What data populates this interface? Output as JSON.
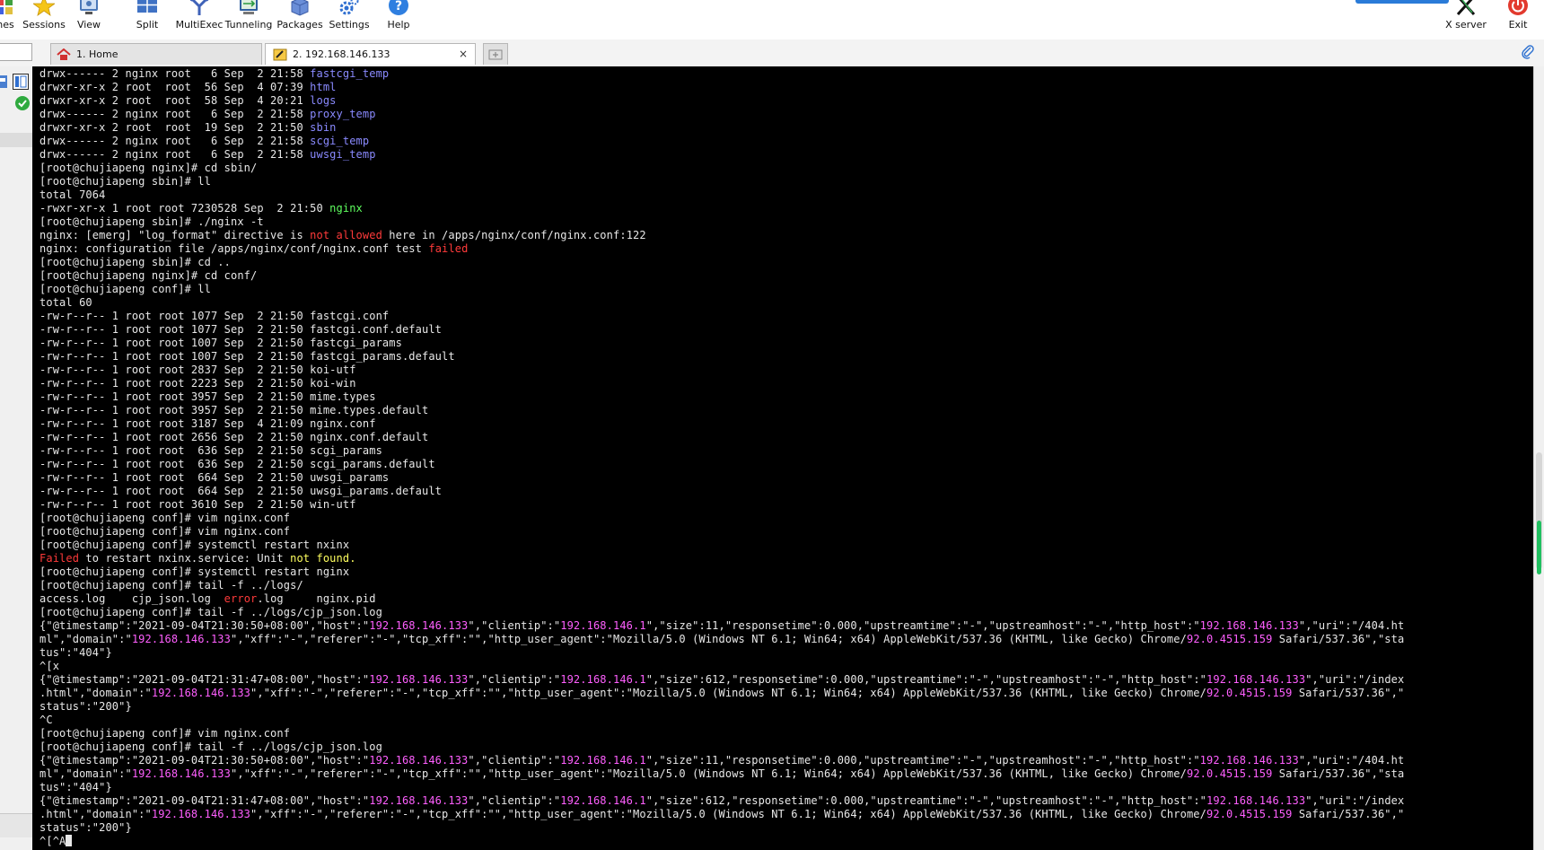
{
  "toolbar": {
    "items": [
      {
        "label": "nes",
        "icon": "games-icon"
      },
      {
        "label": "Sessions",
        "icon": "star-icon"
      },
      {
        "label": "View",
        "icon": "view-icon"
      },
      {
        "label": "Split",
        "icon": "split-icon"
      },
      {
        "label": "MultiExec",
        "icon": "multiexec-icon"
      },
      {
        "label": "Tunneling",
        "icon": "tunneling-icon"
      },
      {
        "label": "Packages",
        "icon": "packages-icon"
      },
      {
        "label": "Settings",
        "icon": "gear-icon"
      },
      {
        "label": "Help",
        "icon": "help-icon"
      }
    ],
    "xserver_label": "X server",
    "exit_label": "Exit"
  },
  "tabs": {
    "home_label": "1. Home",
    "session_label": "2. 192.168.146.133",
    "close_glyph": "×"
  },
  "colors": {
    "terminal_bg": "#000000",
    "dir_blue": "#8a8aff",
    "exec_green": "#5fff5f",
    "error_red": "#ff3a3a",
    "ip_magenta": "#ff5fff",
    "warn_yellow": "#ffff5f"
  },
  "terminal": {
    "lines": [
      [
        [
          "drwx------ 2 nginx root   6 Sep  2 21:58 ",
          ""
        ],
        [
          "fastcgi_temp",
          "blue"
        ]
      ],
      [
        [
          "drwxr-xr-x 2 root  root  56 Sep  4 07:39 ",
          ""
        ],
        [
          "html",
          "blue"
        ]
      ],
      [
        [
          "drwxr-xr-x 2 root  root  58 Sep  4 20:21 ",
          ""
        ],
        [
          "logs",
          "blue"
        ]
      ],
      [
        [
          "drwx------ 2 nginx root   6 Sep  2 21:58 ",
          ""
        ],
        [
          "proxy_temp",
          "blue"
        ]
      ],
      [
        [
          "drwxr-xr-x 2 root  root  19 Sep  2 21:50 ",
          ""
        ],
        [
          "sbin",
          "blue"
        ]
      ],
      [
        [
          "drwx------ 2 nginx root   6 Sep  2 21:58 ",
          ""
        ],
        [
          "scgi_temp",
          "blue"
        ]
      ],
      [
        [
          "drwx------ 2 nginx root   6 Sep  2 21:58 ",
          ""
        ],
        [
          "uwsgi_temp",
          "blue"
        ]
      ],
      [
        [
          "[root@chujiapeng nginx]# cd sbin/",
          ""
        ]
      ],
      [
        [
          "[root@chujiapeng sbin]# ll",
          ""
        ]
      ],
      [
        [
          "total 7064",
          ""
        ]
      ],
      [
        [
          "-rwxr-xr-x 1 root root 7230528 Sep  2 21:50 ",
          ""
        ],
        [
          "nginx",
          "green"
        ]
      ],
      [
        [
          "[root@chujiapeng sbin]# ./nginx -t",
          ""
        ]
      ],
      [
        [
          "nginx: [emerg] \"log_format\" directive is ",
          ""
        ],
        [
          "not allowed",
          "red"
        ],
        [
          " here in /apps/nginx/conf/nginx.conf:122",
          ""
        ]
      ],
      [
        [
          "nginx: configuration file /apps/nginx/conf/nginx.conf test ",
          ""
        ],
        [
          "failed",
          "red"
        ]
      ],
      [
        [
          "[root@chujiapeng sbin]# cd ..",
          ""
        ]
      ],
      [
        [
          "[root@chujiapeng nginx]# cd conf/",
          ""
        ]
      ],
      [
        [
          "[root@chujiapeng conf]# ll",
          ""
        ]
      ],
      [
        [
          "total 60",
          ""
        ]
      ],
      [
        [
          "-rw-r--r-- 1 root root 1077 Sep  2 21:50 fastcgi.conf",
          ""
        ]
      ],
      [
        [
          "-rw-r--r-- 1 root root 1077 Sep  2 21:50 fastcgi.conf.default",
          ""
        ]
      ],
      [
        [
          "-rw-r--r-- 1 root root 1007 Sep  2 21:50 fastcgi_params",
          ""
        ]
      ],
      [
        [
          "-rw-r--r-- 1 root root 1007 Sep  2 21:50 fastcgi_params.default",
          ""
        ]
      ],
      [
        [
          "-rw-r--r-- 1 root root 2837 Sep  2 21:50 koi-utf",
          ""
        ]
      ],
      [
        [
          "-rw-r--r-- 1 root root 2223 Sep  2 21:50 koi-win",
          ""
        ]
      ],
      [
        [
          "-rw-r--r-- 1 root root 3957 Sep  2 21:50 mime.types",
          ""
        ]
      ],
      [
        [
          "-rw-r--r-- 1 root root 3957 Sep  2 21:50 mime.types.default",
          ""
        ]
      ],
      [
        [
          "-rw-r--r-- 1 root root 3187 Sep  4 21:09 nginx.conf",
          ""
        ]
      ],
      [
        [
          "-rw-r--r-- 1 root root 2656 Sep  2 21:50 nginx.conf.default",
          ""
        ]
      ],
      [
        [
          "-rw-r--r-- 1 root root  636 Sep  2 21:50 scgi_params",
          ""
        ]
      ],
      [
        [
          "-rw-r--r-- 1 root root  636 Sep  2 21:50 scgi_params.default",
          ""
        ]
      ],
      [
        [
          "-rw-r--r-- 1 root root  664 Sep  2 21:50 uwsgi_params",
          ""
        ]
      ],
      [
        [
          "-rw-r--r-- 1 root root  664 Sep  2 21:50 uwsgi_params.default",
          ""
        ]
      ],
      [
        [
          "-rw-r--r-- 1 root root 3610 Sep  2 21:50 win-utf",
          ""
        ]
      ],
      [
        [
          "[root@chujiapeng conf]# vim nginx.conf",
          ""
        ]
      ],
      [
        [
          "[root@chujiapeng conf]# vim nginx.conf",
          ""
        ]
      ],
      [
        [
          "[root@chujiapeng conf]# systemctl restart nxinx",
          ""
        ]
      ],
      [
        [
          "Failed",
          "red"
        ],
        [
          " to restart nxinx.service: Unit ",
          ""
        ],
        [
          "not found.",
          "yellow"
        ]
      ],
      [
        [
          "[root@chujiapeng conf]# systemctl restart nginx",
          ""
        ]
      ],
      [
        [
          "[root@chujiapeng conf]# tail -f ../logs/",
          ""
        ]
      ],
      [
        [
          "access.log    cjp_json.log  ",
          ""
        ],
        [
          "error",
          "red"
        ],
        [
          ".log     nginx.pid",
          ""
        ]
      ],
      [
        [
          "[root@chujiapeng conf]# tail -f ../logs/cjp_json.log",
          ""
        ]
      ],
      [
        [
          "{\"@timestamp\":\"2021-09-04T21:30:50+08:00\",\"host\":\"",
          ""
        ],
        [
          "192.168.146.133",
          "magenta"
        ],
        [
          "\",\"clientip\":\"",
          ""
        ],
        [
          "192.168.146.1",
          "magenta"
        ],
        [
          "\",\"size\":11,\"responsetime\":0.000,\"upstreamtime\":\"-\",\"upstreamhost\":\"-\",\"http_host\":\"",
          ""
        ],
        [
          "192.168.146.133",
          "magenta"
        ],
        [
          "\",\"uri\":\"/404.ht",
          ""
        ]
      ],
      [
        [
          "ml\",\"domain\":\"",
          ""
        ],
        [
          "192.168.146.133",
          "magenta"
        ],
        [
          "\",\"xff\":\"-\",\"referer\":\"-\",\"tcp_xff\":\"\",\"http_user_agent\":\"Mozilla/5.0 (Windows NT 6.1; Win64; x64) AppleWebKit/537.36 (KHTML, like Gecko) Chrome/",
          ""
        ],
        [
          "92.0.4515.159",
          "magenta"
        ],
        [
          " Safari/537.36\",\"sta",
          ""
        ]
      ],
      [
        [
          "tus\":\"404\"}",
          ""
        ]
      ],
      [
        [
          "^[x",
          ""
        ]
      ],
      [
        [
          "{\"@timestamp\":\"2021-09-04T21:31:47+08:00\",\"host\":\"",
          ""
        ],
        [
          "192.168.146.133",
          "magenta"
        ],
        [
          "\",\"clientip\":\"",
          ""
        ],
        [
          "192.168.146.1",
          "magenta"
        ],
        [
          "\",\"size\":612,\"responsetime\":0.000,\"upstreamtime\":\"-\",\"upstreamhost\":\"-\",\"http_host\":\"",
          ""
        ],
        [
          "192.168.146.133",
          "magenta"
        ],
        [
          "\",\"uri\":\"/index",
          ""
        ]
      ],
      [
        [
          ".html\",\"domain\":\"",
          ""
        ],
        [
          "192.168.146.133",
          "magenta"
        ],
        [
          "\",\"xff\":\"-\",\"referer\":\"-\",\"tcp_xff\":\"\",\"http_user_agent\":\"Mozilla/5.0 (Windows NT 6.1; Win64; x64) AppleWebKit/537.36 (KHTML, like Gecko) Chrome/",
          ""
        ],
        [
          "92.0.4515.159",
          "magenta"
        ],
        [
          " Safari/537.36\",\"",
          ""
        ]
      ],
      [
        [
          "status\":\"200\"}",
          ""
        ]
      ],
      [
        [
          "^C",
          ""
        ]
      ],
      [
        [
          "[root@chujiapeng conf]# vim nginx.conf",
          ""
        ]
      ],
      [
        [
          "[root@chujiapeng conf]# tail -f ../logs/cjp_json.log",
          ""
        ]
      ],
      [
        [
          "{\"@timestamp\":\"2021-09-04T21:30:50+08:00\",\"host\":\"",
          ""
        ],
        [
          "192.168.146.133",
          "magenta"
        ],
        [
          "\",\"clientip\":\"",
          ""
        ],
        [
          "192.168.146.1",
          "magenta"
        ],
        [
          "\",\"size\":11,\"responsetime\":0.000,\"upstreamtime\":\"-\",\"upstreamhost\":\"-\",\"http_host\":\"",
          ""
        ],
        [
          "192.168.146.133",
          "magenta"
        ],
        [
          "\",\"uri\":\"/404.ht",
          ""
        ]
      ],
      [
        [
          "ml\",\"domain\":\"",
          ""
        ],
        [
          "192.168.146.133",
          "magenta"
        ],
        [
          "\",\"xff\":\"-\",\"referer\":\"-\",\"tcp_xff\":\"\",\"http_user_agent\":\"Mozilla/5.0 (Windows NT 6.1; Win64; x64) AppleWebKit/537.36 (KHTML, like Gecko) Chrome/",
          ""
        ],
        [
          "92.0.4515.159",
          "magenta"
        ],
        [
          " Safari/537.36\",\"sta",
          ""
        ]
      ],
      [
        [
          "tus\":\"404\"}",
          ""
        ]
      ],
      [
        [
          "{\"@timestamp\":\"2021-09-04T21:31:47+08:00\",\"host\":\"",
          ""
        ],
        [
          "192.168.146.133",
          "magenta"
        ],
        [
          "\",\"clientip\":\"",
          ""
        ],
        [
          "192.168.146.1",
          "magenta"
        ],
        [
          "\",\"size\":612,\"responsetime\":0.000,\"upstreamtime\":\"-\",\"upstreamhost\":\"-\",\"http_host\":\"",
          ""
        ],
        [
          "192.168.146.133",
          "magenta"
        ],
        [
          "\",\"uri\":\"/index",
          ""
        ]
      ],
      [
        [
          ".html\",\"domain\":\"",
          ""
        ],
        [
          "192.168.146.133",
          "magenta"
        ],
        [
          "\",\"xff\":\"-\",\"referer\":\"-\",\"tcp_xff\":\"\",\"http_user_agent\":\"Mozilla/5.0 (Windows NT 6.1; Win64; x64) AppleWebKit/537.36 (KHTML, like Gecko) Chrome/",
          ""
        ],
        [
          "92.0.4515.159",
          "magenta"
        ],
        [
          " Safari/537.36\",\"",
          ""
        ]
      ],
      [
        [
          "status\":\"200\"}",
          ""
        ]
      ],
      [
        [
          "^[^A",
          ""
        ]
      ]
    ]
  }
}
